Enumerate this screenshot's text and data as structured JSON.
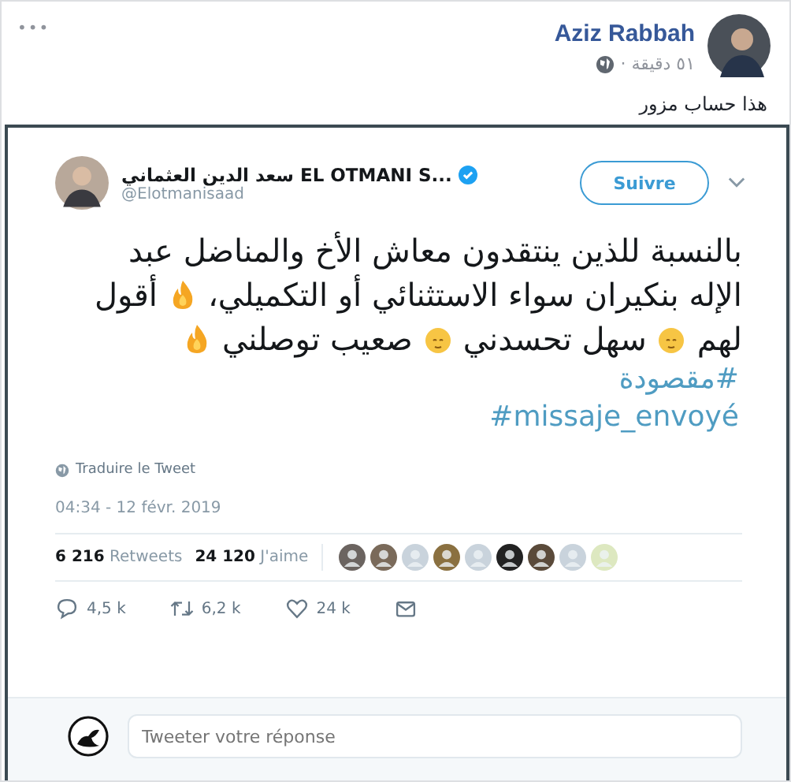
{
  "post": {
    "menu": "•••",
    "author": "Aziz Rabbah",
    "time": "٥١ دقيقة ·",
    "text": "هذا حساب مزور"
  },
  "tweet": {
    "name": "سعد الدين العثماني EL OTMANI S...",
    "handle": "@Elotmanisaad",
    "verified": true,
    "follow": "Suivre",
    "body": [
      {
        "kind": "text",
        "text": "بالنسبة للذين ينتقدون معاش الأخ والمناضل عبد"
      },
      {
        "kind": "text",
        "text": "الإله بنكيران سواء الاستثنائي أو التكميلي،"
      },
      {
        "kind": "fire"
      },
      {
        "kind": "text",
        "text": "أقول"
      },
      {
        "kind": "text",
        "text": "لهم"
      },
      {
        "kind": "face"
      },
      {
        "kind": "text",
        "text": "سهل تحسدني"
      },
      {
        "kind": "face"
      },
      {
        "kind": "text",
        "text": "صعيب توصلني"
      },
      {
        "kind": "fire"
      }
    ],
    "hashtags": [
      "#مقصودة",
      "#missaje_envoyé"
    ],
    "translate": "Traduire le Tweet",
    "date": "04:34 - 12 févr. 2019",
    "retweets": {
      "count": "6 216",
      "label": "Retweets"
    },
    "likes": {
      "count": "24 120",
      "label": "J'aime"
    },
    "reply_count": "4,5 k",
    "retweet_count": "6,2 k",
    "like_count": "24 k",
    "reply_placeholder": "Tweeter votre réponse"
  }
}
